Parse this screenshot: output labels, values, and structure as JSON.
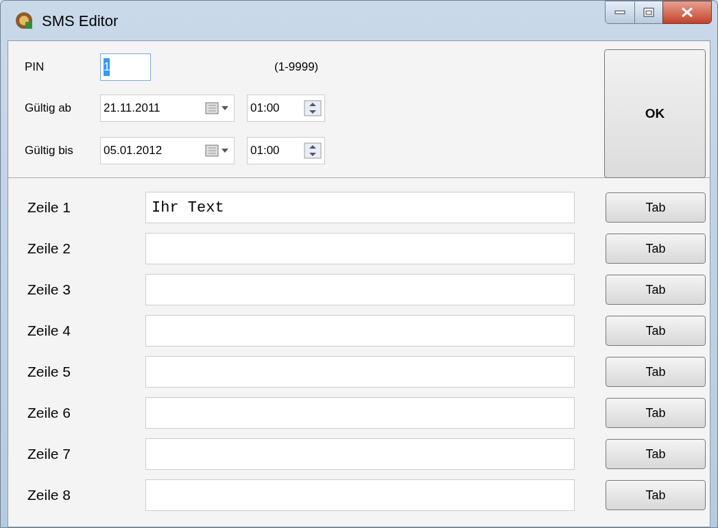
{
  "window": {
    "title": "SMS Editor"
  },
  "pin": {
    "label": "PIN",
    "value": "1",
    "range": "(1-9999)"
  },
  "validity": [
    {
      "label": "Gültig ab",
      "date": "21.11.2011",
      "time": "01:00"
    },
    {
      "label": "Gültig bis",
      "date": "05.01.2012",
      "time": "01:00"
    }
  ],
  "ok_button": "OK",
  "lines": [
    {
      "label": "Zeile 1",
      "value": "Ihr Text",
      "button": "Tab"
    },
    {
      "label": "Zeile 2",
      "button": "Tab"
    },
    {
      "label": "Zeile 3",
      "button": "Tab"
    },
    {
      "label": "Zeile 4",
      "button": "Tab"
    },
    {
      "label": "Zeile 5",
      "button": "Tab"
    },
    {
      "label": "Zeile 6",
      "button": "Tab"
    },
    {
      "label": "Zeile 7",
      "button": "Tab"
    },
    {
      "label": "Zeile 8",
      "button": "Tab"
    }
  ]
}
